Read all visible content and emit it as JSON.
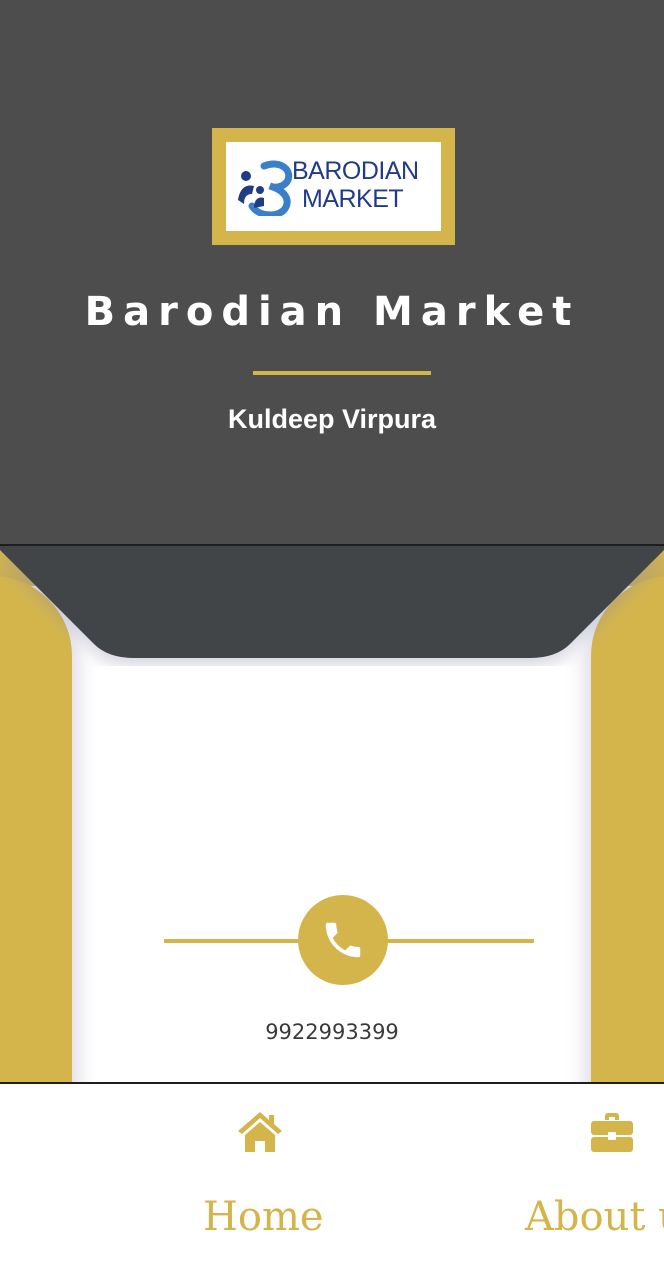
{
  "header": {
    "logo": {
      "line1": "BARODIAN",
      "line2": "MARKET"
    },
    "brand_title": "Barodian Market",
    "owner_name": "Kuldeep Virpura"
  },
  "contact": {
    "phone_icon": "phone-icon",
    "phone_number": "9922993399"
  },
  "bottom_nav": {
    "items": [
      {
        "icon": "home-icon",
        "label": "Home"
      },
      {
        "icon": "briefcase-icon",
        "label": "About u"
      }
    ]
  },
  "colors": {
    "header_bg": "#4d4d4e",
    "accent_gold": "#d4b54c",
    "logo_blue": "#223b87",
    "notch_dark": "#434446"
  }
}
